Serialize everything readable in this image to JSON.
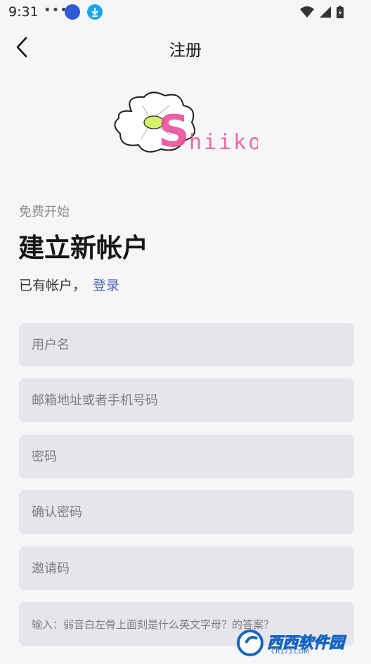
{
  "status_bar": {
    "time": "9:31",
    "dots": "•••",
    "icons": [
      "messenger-icon",
      "download-icon",
      "wifi-icon",
      "signal-icon",
      "battery-icon"
    ]
  },
  "header": {
    "title": "注册",
    "back_icon": "chevron-left-icon"
  },
  "logo": {
    "text": "Shiiko",
    "colors": {
      "pink": "#e9519b",
      "green": "#d6f06a",
      "outline": "#222222"
    }
  },
  "intro": {
    "subtitle": "免费开始",
    "headline": "建立新帐户",
    "have_account": "已有帐户，",
    "login_link": "登录"
  },
  "form": {
    "username_placeholder": "用户名",
    "email_placeholder": "邮箱地址或者手机号码",
    "password_placeholder": "密码",
    "confirm_placeholder": "确认密码",
    "invite_placeholder": "邀请码",
    "question_placeholder": "输入：弱音白左骨上面刻是什么英文字母？的答案？"
  },
  "watermark": {
    "text": "西西软件园",
    "sub": "CR173.COM"
  },
  "colors": {
    "background": "#f6f6f8",
    "field_bg": "#e6e6ea",
    "link": "#4a6ab8"
  }
}
